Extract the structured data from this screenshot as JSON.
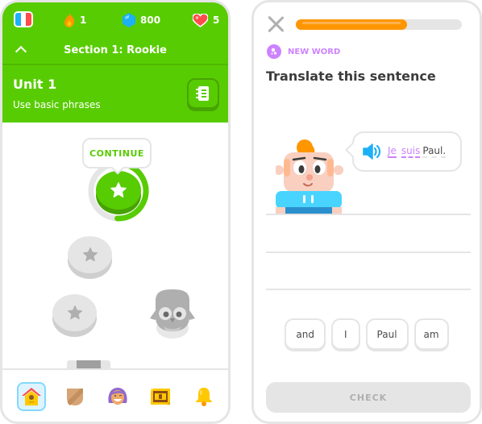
{
  "left": {
    "stats": {
      "course_flag": "french-flag-icon",
      "streak_count": "1",
      "gems_count": "800",
      "hearts_count": "5"
    },
    "section_title": "Section 1: Rookie",
    "unit": {
      "title": "Unit 1",
      "subtitle": "Use basic phrases"
    },
    "path": {
      "continue_label": "CONTINUE",
      "active_lesson_progress": 0.45
    },
    "bottom_nav": [
      {
        "name": "learn",
        "icon": "home-icon",
        "active": true
      },
      {
        "name": "leagues",
        "icon": "shield-icon",
        "active": false
      },
      {
        "name": "profile",
        "icon": "avatar-icon",
        "active": false
      },
      {
        "name": "shop",
        "icon": "chest-icon",
        "active": false
      },
      {
        "name": "notifications",
        "icon": "bell-icon",
        "active": false
      }
    ]
  },
  "right": {
    "progress": 0.67,
    "badge_label": "NEW WORD",
    "prompt": "Translate this sentence",
    "speech": {
      "words": [
        {
          "text": "Je",
          "hint": true
        },
        {
          "text": "suis",
          "hint": true
        },
        {
          "text": "Paul.",
          "hint": false
        }
      ]
    },
    "word_bank": [
      "and",
      "I",
      "Paul",
      "am"
    ],
    "check_label": "CHECK"
  },
  "colors": {
    "brand_green": "#58cc02",
    "progress_orange": "#ff9600",
    "new_word_purple": "#ce82ff",
    "speaker_blue": "#1cb0f6"
  }
}
